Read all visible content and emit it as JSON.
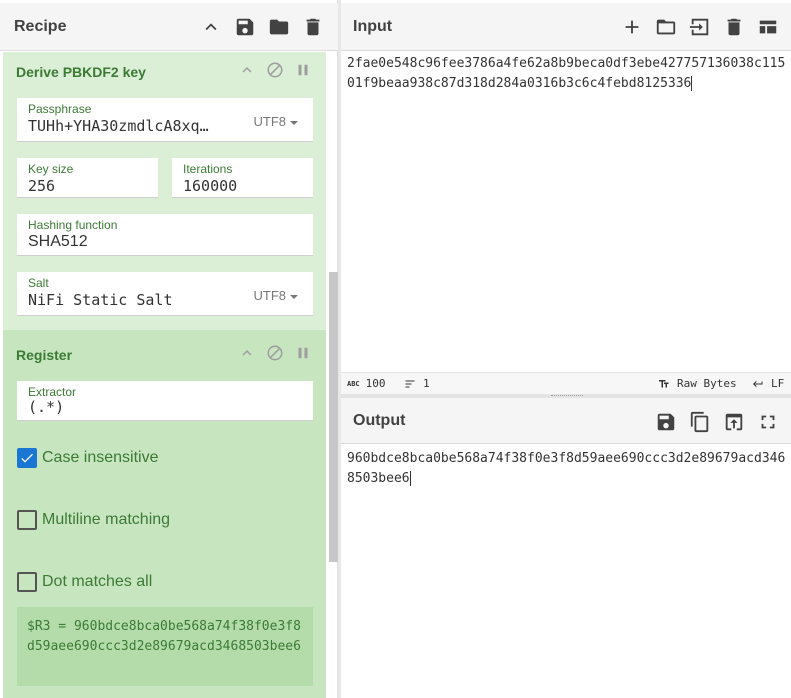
{
  "recipe": {
    "title": "Recipe",
    "ops": {
      "pbkdf2": {
        "title": "Derive PBKDF2 key",
        "passphrase": {
          "label": "Passphrase",
          "value": "TUHh+YHA30zmdlcA8xq…",
          "encoding": "UTF8"
        },
        "key_size": {
          "label": "Key size",
          "value": "256"
        },
        "iterations": {
          "label": "Iterations",
          "value": "160000"
        },
        "hashing": {
          "label": "Hashing function",
          "value": "SHA512"
        },
        "salt": {
          "label": "Salt",
          "value": "NiFi Static Salt",
          "encoding": "UTF8"
        }
      },
      "register": {
        "title": "Register",
        "extractor": {
          "label": "Extractor",
          "value": "(.*)"
        },
        "case_insensitive": {
          "label": "Case insensitive",
          "checked": true
        },
        "multiline": {
          "label": "Multiline matching",
          "checked": false
        },
        "dot_all": {
          "label": "Dot matches all",
          "checked": false
        },
        "output": "$R3 = 960bdce8bca0be568a74f38f0e3f8d59aee690ccc3d2e89679acd3468503bee6"
      }
    }
  },
  "input": {
    "title": "Input",
    "text": "2fae0e548c96fee3786a4fe62a8b9beca0df3ebe427757136038c11501f9beaa938c87d318d284a0316b3c6c4febd8125336",
    "status": {
      "length": "100",
      "lines": "1",
      "raw_bytes": "Raw Bytes",
      "eol": "LF"
    }
  },
  "output": {
    "title": "Output",
    "text": "960bdce8bca0be568a74f38f0e3f8d59aee690ccc3d2e89679acd3468503bee6"
  },
  "colors": {
    "accent": "#1976d2",
    "op_bg": "#dbeed6",
    "register_bg": "#c7e6c0",
    "label": "#3c7a35"
  }
}
